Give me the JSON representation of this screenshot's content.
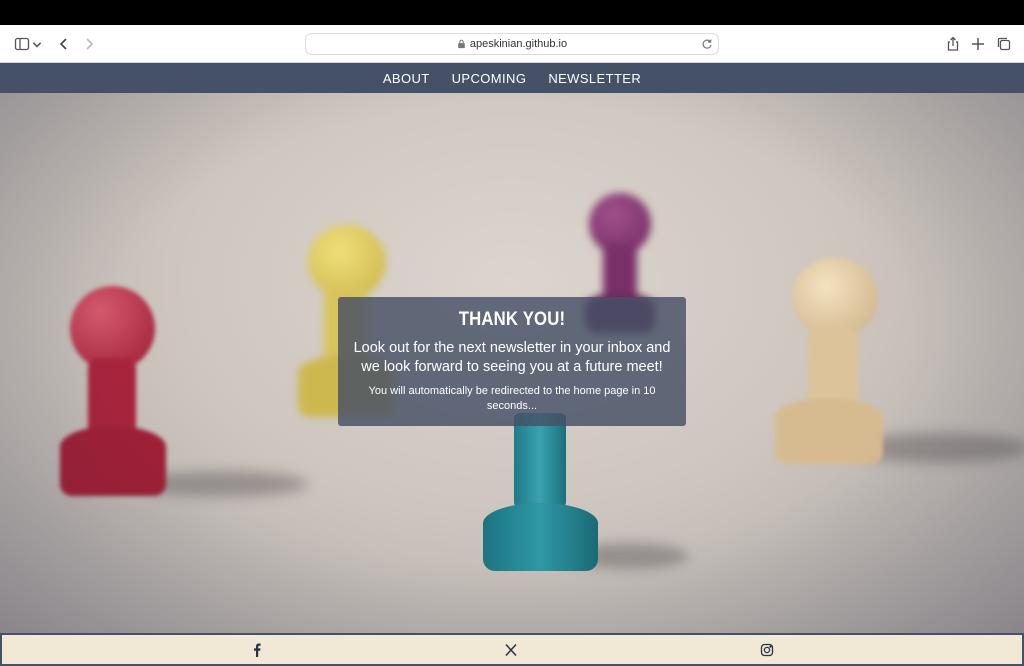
{
  "browser": {
    "url": "apeskinian.github.io"
  },
  "nav": {
    "items": [
      "ABOUT",
      "UPCOMING",
      "NEWSLETTER"
    ]
  },
  "modal": {
    "title": "THANK YOU!",
    "message": "Look out for the next newsletter in your inbox and we look forward to seeing you at a future meet!",
    "redirect": "You will automatically be redirected to the home page in 10 seconds..."
  },
  "colors": {
    "nav_bg": "#455166",
    "footer_bg": "#f1e8d6",
    "modal_bg": "#455166"
  },
  "footer": {
    "icons": [
      "facebook-icon",
      "x-icon",
      "instagram-icon"
    ]
  }
}
